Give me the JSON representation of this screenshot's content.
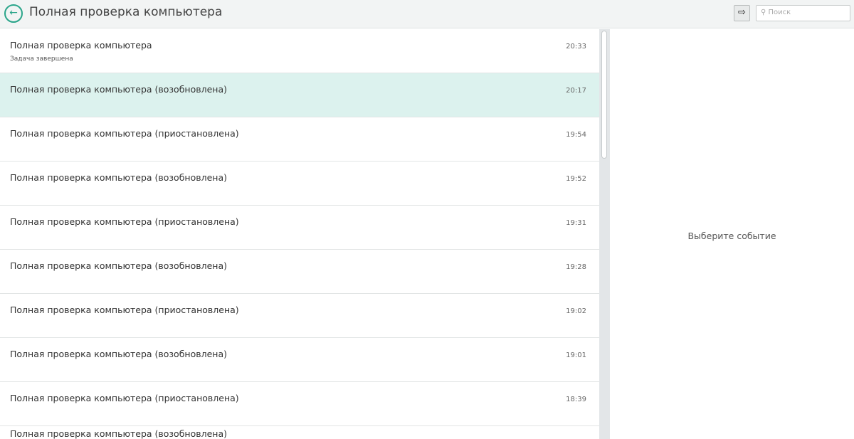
{
  "header": {
    "title": "Полная проверка компьютера",
    "search_placeholder": "Поиск",
    "search_icon": "search-icon",
    "export_icon": "export-icon"
  },
  "events": [
    {
      "name": "Полная проверка компьютера",
      "sub": "Задача завершена",
      "time": "20:33"
    },
    {
      "name": "Полная проверка компьютера (возобновлена)",
      "time": "20:17",
      "selected": true
    },
    {
      "name": "Полная проверка компьютера (приостановлена)",
      "time": "19:54"
    },
    {
      "name": "Полная проверка компьютера (возобновлена)",
      "time": "19:52"
    },
    {
      "name": "Полная проверка компьютера (приостановлена)",
      "time": "19:31"
    },
    {
      "name": "Полная проверка компьютера (возобновлена)",
      "time": "19:28"
    },
    {
      "name": "Полная проверка компьютера (приостановлена)",
      "time": "19:02"
    },
    {
      "name": "Полная проверка компьютера (возобновлена)",
      "time": "19:01"
    },
    {
      "name": "Полная проверка компьютера (приостановлена)",
      "time": "18:39"
    },
    {
      "name": "Полная проверка компьютера (возобновлена)",
      "time": ""
    }
  ],
  "detail": {
    "empty_text": "Выберите событие"
  },
  "colors": {
    "accent": "#2aa58a",
    "selected": "#dcf2ee"
  }
}
